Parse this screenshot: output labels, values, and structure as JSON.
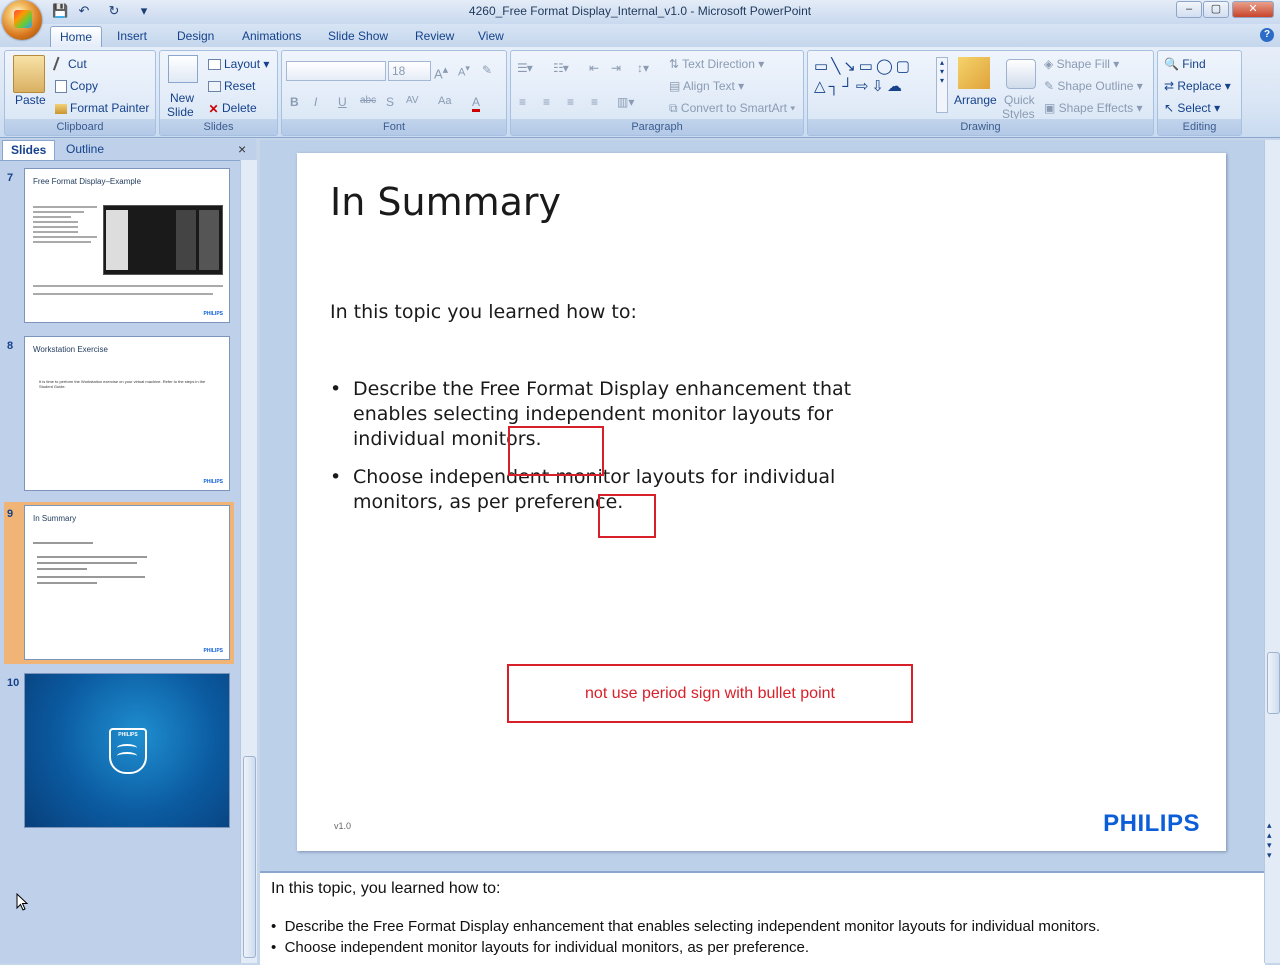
{
  "window": {
    "title": "4260_Free Format Display_Internal_v1.0 - Microsoft PowerPoint",
    "min": "–",
    "max": "▢",
    "close": "✕",
    "help": "?"
  },
  "qat": {
    "save": "💾",
    "undo": "↶",
    "redo": "↻",
    "more": "▾"
  },
  "tabs": [
    "Home",
    "Insert",
    "Design",
    "Animations",
    "Slide Show",
    "Review",
    "View"
  ],
  "ribbon": {
    "clipboard": {
      "label": "Clipboard",
      "paste": "Paste",
      "cut": "Cut",
      "copy": "Copy",
      "format_painter": "Format Painter"
    },
    "slides": {
      "label": "Slides",
      "new_slide_1": "New",
      "new_slide_2": "Slide",
      "layout": "Layout",
      "reset": "Reset",
      "delete": "Delete"
    },
    "font": {
      "label": "Font",
      "font_name": "",
      "font_size": "18"
    },
    "paragraph": {
      "label": "Paragraph",
      "text_direction": "Text Direction",
      "align_text": "Align Text",
      "convert_smartart": "Convert to SmartArt"
    },
    "drawing": {
      "label": "Drawing",
      "arrange": "Arrange",
      "quick_styles_1": "Quick",
      "quick_styles_2": "Styles",
      "shape_fill": "Shape Fill",
      "shape_outline": "Shape Outline",
      "shape_effects": "Shape Effects"
    },
    "editing": {
      "label": "Editing",
      "find": "Find",
      "replace": "Replace",
      "select": "Select"
    }
  },
  "panel": {
    "tab_slides": "Slides",
    "tab_outline": "Outline",
    "close": "×",
    "thumbs": [
      {
        "num": "7",
        "title": "Free Format Display–Example",
        "logo": "PHILIPS"
      },
      {
        "num": "8",
        "title": "Workstation Exercise",
        "body": "It is time to perform the Workstation exercise on your virtual machine. Refer to the steps in the Student Guide.",
        "logo": "PHILIPS"
      },
      {
        "num": "9",
        "title": "In Summary",
        "logo": "PHILIPS"
      },
      {
        "num": "10",
        "logo": "PHILIPS"
      }
    ]
  },
  "slide": {
    "title": "In Summary",
    "intro": "In this topic you learned how to:",
    "bullets": [
      "Describe the Free Format Display enhancement that enables selecting independent monitor layouts for individual monitors.",
      "Choose independent monitor layouts for individual monitors, as per preference."
    ],
    "comment": "not use period sign with bullet point",
    "version": "v1.0",
    "logo": "PHILIPS"
  },
  "notes": {
    "intro": "In this topic, you learned how to:",
    "items": [
      "Describe the Free  Format Display enhancement  that enables selecting independent monitor layouts for individual monitors.",
      "Choose independent monitor layouts for individual monitors, as per preference."
    ]
  },
  "colors": {
    "accent": "#15428b",
    "annotation": "#d8202a",
    "philips_blue": "#0b5ed7",
    "selection": "#e9943b"
  }
}
